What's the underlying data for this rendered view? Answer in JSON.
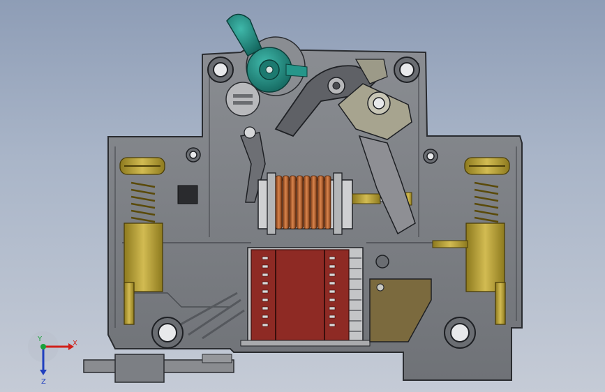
{
  "viewport": {
    "background_top": "#8e9db6",
    "background_bottom": "#c5cbd6"
  },
  "model": {
    "body_color": "#7f8287",
    "body_edge_color": "#2a2c30",
    "handle_color": "#1e8a80",
    "coil_color": "#b5622f",
    "arc_chamber_color": "#8e2a24",
    "brass_color": "#b49a2e",
    "lever_color": "#9c9a88",
    "rail_clip_color": "#8a8c90"
  },
  "triad": {
    "x_label": "X",
    "y_label": "Y",
    "z_label": "Z",
    "x_color": "#d0201a",
    "y_color": "#19a23a",
    "z_color": "#1f3fbf"
  }
}
